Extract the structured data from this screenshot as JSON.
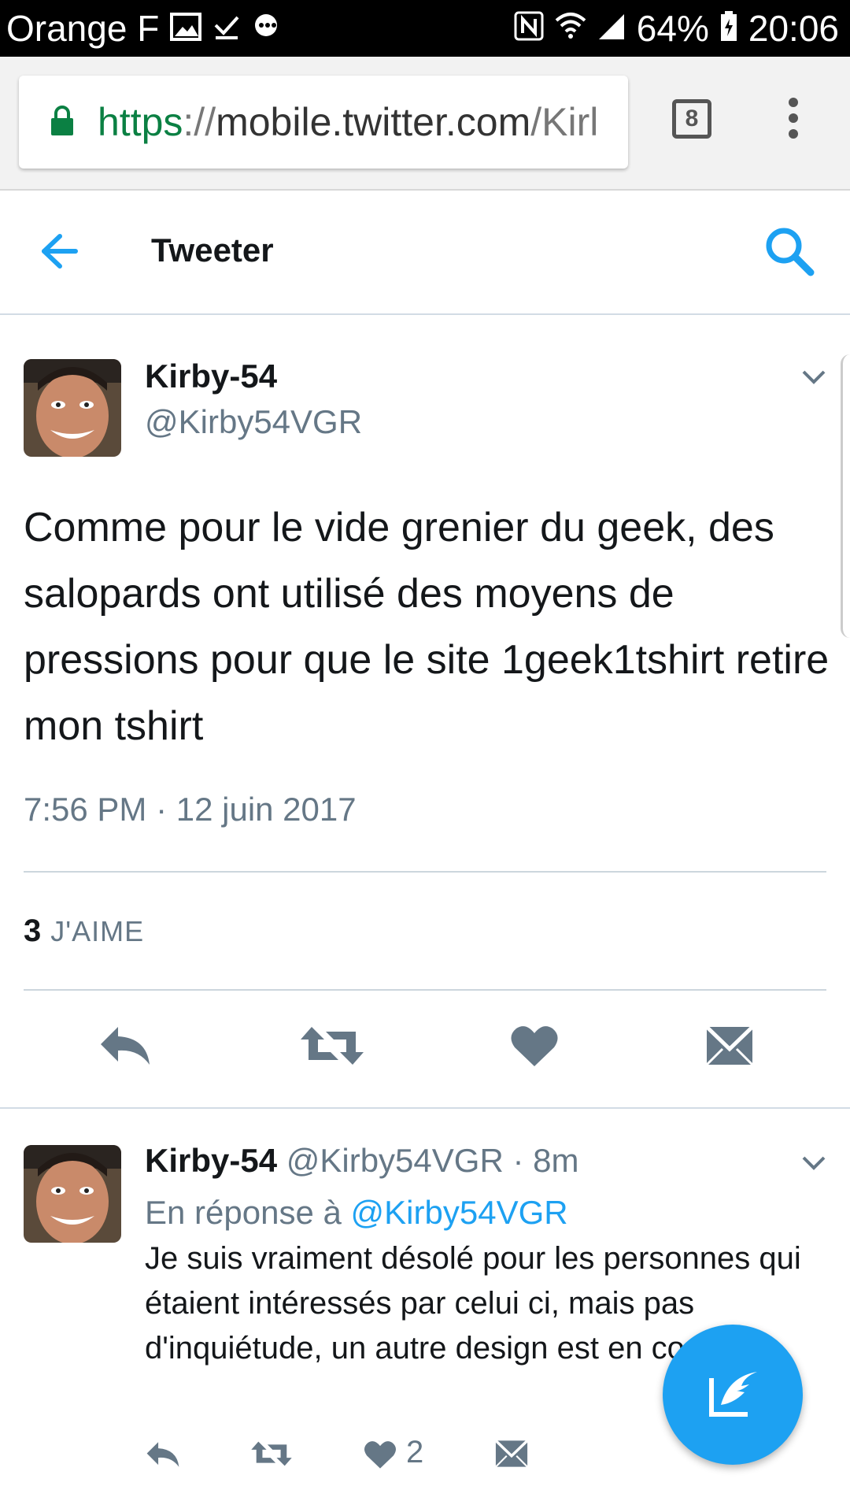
{
  "status_bar": {
    "carrier": "Orange F",
    "battery": "64%",
    "time": "20:06"
  },
  "browser": {
    "url_scheme": "https",
    "url_sep": "://",
    "url_host": "mobile.twitter.com",
    "url_rest": "/Kirl",
    "tab_count": "8"
  },
  "header": {
    "title": "Tweeter"
  },
  "tweet": {
    "name": "Kirby-54",
    "handle": "@Kirby54VGR",
    "text": "Comme pour le vide grenier du geek, des salopards ont utilisé des moyens de pressions pour que le site 1geek1tshirt retire mon tshirt",
    "timestamp": "7:56 PM · 12 juin 2017",
    "likes_count": "3",
    "likes_label": "J'AIME"
  },
  "reply": {
    "name": "Kirby-54",
    "handle": "@Kirby54VGR",
    "time": "· 8m",
    "replying_to_label": "En réponse à",
    "replying_to_handle": "@Kirby54VGR",
    "text": "Je suis vraiment désolé pour les personnes qui étaient intéressés par celui ci, mais pas d'inquiétude, un autre design est en cours :)",
    "like_count": "2"
  },
  "colors": {
    "accent": "#1da1f2",
    "secondary_text": "#657786",
    "action_icon": "#657786"
  }
}
